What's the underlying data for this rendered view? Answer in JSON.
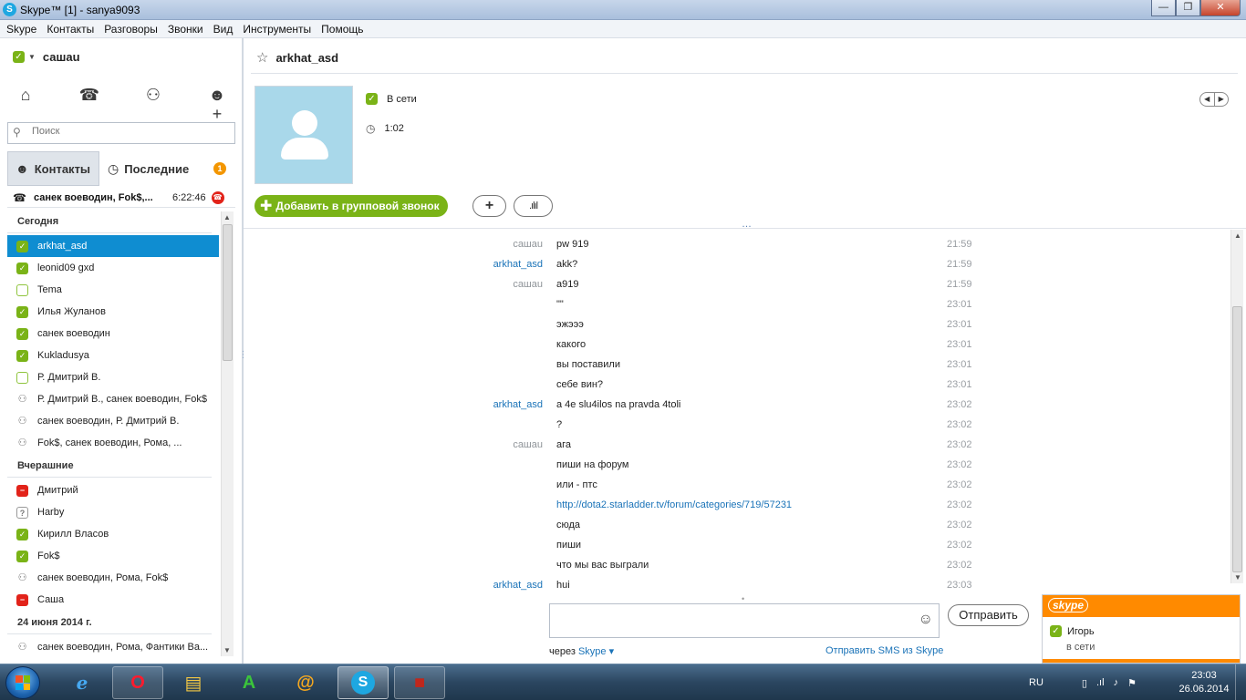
{
  "window": {
    "title": "Skype™ [1] - sanya9093"
  },
  "menu": [
    "Skype",
    "Контакты",
    "Разговоры",
    "Звонки",
    "Вид",
    "Инструменты",
    "Помощь"
  ],
  "user": {
    "name": "сашаu"
  },
  "search": {
    "placeholder": "Поиск"
  },
  "tabs": {
    "contacts": "Контакты",
    "recent": "Последние",
    "recent_badge": "1"
  },
  "active_call": {
    "name": "санек воеводин, Fok$,...",
    "time": "6:22:46"
  },
  "sections": [
    {
      "title": "Сегодня",
      "items": [
        {
          "name": "arkhat_asd",
          "status": "online",
          "selected": true
        },
        {
          "name": "leonid09 gxd",
          "status": "online"
        },
        {
          "name": "Tema",
          "status": "offline"
        },
        {
          "name": "Илья Жуланов",
          "status": "online"
        },
        {
          "name": "санек воеводин",
          "status": "online"
        },
        {
          "name": "Kukladusya",
          "status": "online"
        },
        {
          "name": "Р. Дмитрий В.",
          "status": "offline"
        },
        {
          "name": "Р. Дмитрий В., санек воеводин, Fok$",
          "status": "group"
        },
        {
          "name": "санек воеводин, Р. Дмитрий В.",
          "status": "group"
        },
        {
          "name": "Fok$, санек воеводин, Рома, ...",
          "status": "group"
        }
      ]
    },
    {
      "title": "Вчерашние",
      "items": [
        {
          "name": "Дмитрий",
          "status": "busy"
        },
        {
          "name": "Harby",
          "status": "unknown"
        },
        {
          "name": "Кирилл Власов",
          "status": "online"
        },
        {
          "name": "Fok$",
          "status": "online"
        },
        {
          "name": "санек воеводин, Рома, Fok$",
          "status": "group"
        },
        {
          "name": "Саша",
          "status": "busy"
        }
      ]
    },
    {
      "title": "24 июня 2014 г.",
      "items": [
        {
          "name": "санек воеводин, Рома, Фантики Ва...",
          "status": "group"
        }
      ]
    }
  ],
  "conversation": {
    "contact": "arkhat_asd",
    "status_text": "В сети",
    "local_time": "1:02",
    "add_to_group_call": "Добавить в групповой звонок"
  },
  "messages": [
    {
      "sender": "сашаu",
      "peer": false,
      "text": "pw 919",
      "time": "21:59"
    },
    {
      "sender": "arkhat_asd",
      "peer": true,
      "text": "akk?",
      "time": "21:59"
    },
    {
      "sender": "сашаu",
      "peer": false,
      "text": "a919",
      "time": "21:59"
    },
    {
      "sender": "",
      "peer": false,
      "text": "\"\"",
      "time": "23:01"
    },
    {
      "sender": "",
      "peer": false,
      "text": "эжэээ",
      "time": "23:01"
    },
    {
      "sender": "",
      "peer": false,
      "text": "какого",
      "time": "23:01"
    },
    {
      "sender": "",
      "peer": false,
      "text": "вы поставили",
      "time": "23:01"
    },
    {
      "sender": "",
      "peer": false,
      "text": "себе вин?",
      "time": "23:01"
    },
    {
      "sender": "arkhat_asd",
      "peer": true,
      "text": "a 4e slu4ilos na pravda 4toli",
      "time": "23:02"
    },
    {
      "sender": "",
      "peer": true,
      "text": "?",
      "time": "23:02"
    },
    {
      "sender": "сашаu",
      "peer": false,
      "text": "ага",
      "time": "23:02"
    },
    {
      "sender": "",
      "peer": false,
      "text": "пиши на форум",
      "time": "23:02"
    },
    {
      "sender": "",
      "peer": false,
      "text": "или - птс",
      "time": "23:02"
    },
    {
      "sender": "",
      "peer": false,
      "text": "http://dota2.starladder.tv/forum/categories/719/57231",
      "time": "23:02",
      "link": true
    },
    {
      "sender": "",
      "peer": false,
      "text": "сюда",
      "time": "23:02"
    },
    {
      "sender": "",
      "peer": false,
      "text": "пиши",
      "time": "23:02"
    },
    {
      "sender": "",
      "peer": false,
      "text": "что мы вас выграли",
      "time": "23:02"
    },
    {
      "sender": "arkhat_asd",
      "peer": true,
      "text": "hui",
      "time": "23:03"
    }
  ],
  "compose": {
    "send": "Отправить",
    "via_label": "через",
    "via_service": "Skype",
    "sms_link": "Отправить SMS из Skype"
  },
  "notification": {
    "brand": "skype",
    "name": "Игорь",
    "status": "в сети"
  },
  "taskbar": {
    "language": "RU",
    "time": "23:03",
    "date": "26.06.2014",
    "apps": [
      "internet-explorer",
      "opera",
      "file-explorer",
      "app-a",
      "mail-agent",
      "skype",
      "dota-2"
    ]
  }
}
